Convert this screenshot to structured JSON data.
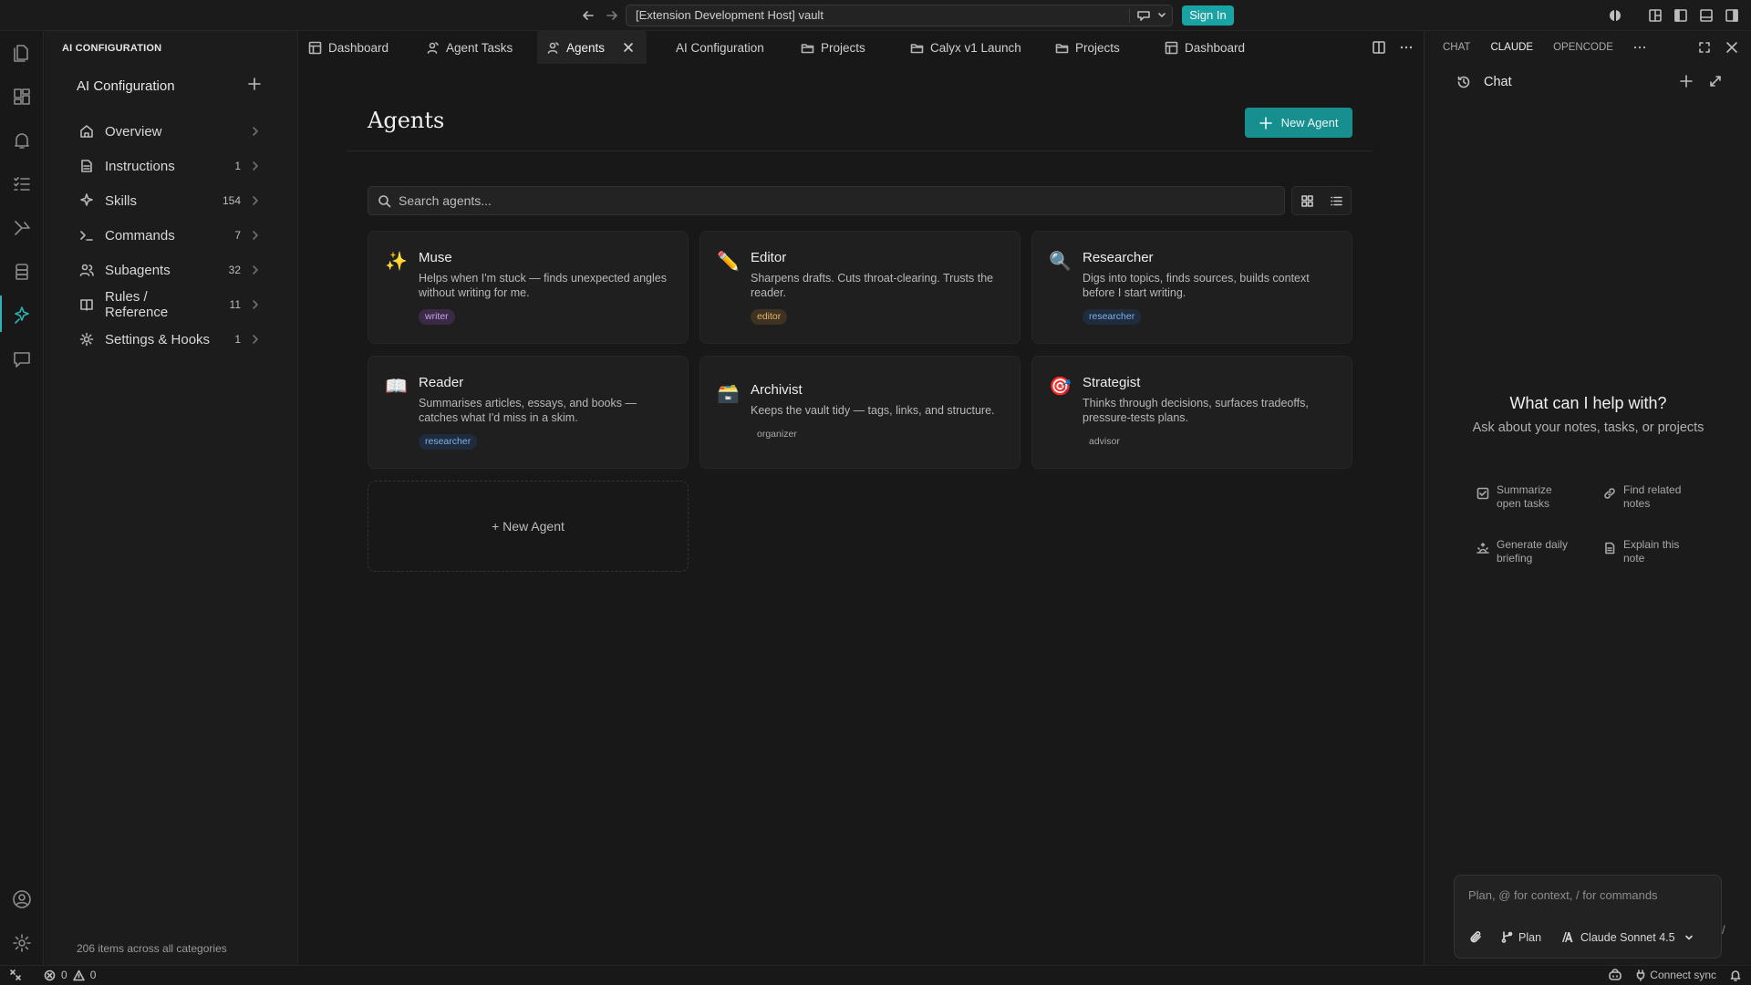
{
  "titlebar": {
    "command_center": "[Extension Development Host] vault",
    "signin_label": "Sign In"
  },
  "sidebar": {
    "header": "AI CONFIGURATION",
    "title": "AI Configuration",
    "items": [
      {
        "label": "Overview",
        "count": "",
        "icon": "home-icon"
      },
      {
        "label": "Instructions",
        "count": "1",
        "icon": "document-icon"
      },
      {
        "label": "Skills",
        "count": "154",
        "icon": "sparkle-icon"
      },
      {
        "label": "Commands",
        "count": "7",
        "icon": "terminal-icon"
      },
      {
        "label": "Subagents",
        "count": "32",
        "icon": "users-icon"
      },
      {
        "label": "Rules / Reference",
        "count": "11",
        "icon": "book-icon"
      },
      {
        "label": "Settings & Hooks",
        "count": "1",
        "icon": "gear-icon"
      }
    ],
    "footer": "206 items across all categories"
  },
  "tabs": [
    {
      "label": "Dashboard",
      "icon": "table-icon"
    },
    {
      "label": "Agent Tasks",
      "icon": "agent-icon"
    },
    {
      "label": "Agents",
      "icon": "agent-icon",
      "active": true
    },
    {
      "label": "AI Configuration",
      "icon": ""
    },
    {
      "label": "Projects",
      "icon": "folder-icon"
    },
    {
      "label": "Calyx v1 Launch",
      "icon": "folder-icon"
    },
    {
      "label": "Projects",
      "icon": "folder-icon"
    },
    {
      "label": "Dashboard",
      "icon": "table-icon"
    }
  ],
  "main": {
    "title": "Agents",
    "new_agent_label": "New Agent",
    "search_placeholder": "Search agents...",
    "agents": [
      {
        "emoji": "✨",
        "name": "Muse",
        "description": "Helps when I'm stuck — finds unexpected angles without writing for me.",
        "tag": "writer"
      },
      {
        "emoji": "✏️",
        "name": "Editor",
        "description": "Sharpens drafts. Cuts throat-clearing. Trusts the reader.",
        "tag": "editor"
      },
      {
        "emoji": "🔍",
        "name": "Researcher",
        "description": "Digs into topics, finds sources, builds context before I start writing.",
        "tag": "researcher"
      },
      {
        "emoji": "📖",
        "name": "Reader",
        "description": "Summarises articles, essays, and books — catches what I'd miss in a skim.",
        "tag": "researcher"
      },
      {
        "emoji": "🗃️",
        "name": "Archivist",
        "description": "Keeps the vault tidy — tags, links, and structure.",
        "tag": "organizer"
      },
      {
        "emoji": "🎯",
        "name": "Strategist",
        "description": "Thinks through decisions, surfaces tradeoffs, pressure-tests plans.",
        "tag": "advisor"
      }
    ],
    "new_agent_card_label": "+ New Agent"
  },
  "chat": {
    "tabs": [
      "CHAT",
      "CLAUDE",
      "OPENCODE"
    ],
    "active_tab": "CLAUDE",
    "header_title": "Chat",
    "heading": "What can I help with?",
    "subheading": "Ask about your notes, tasks, or projects",
    "suggestions": [
      {
        "label": "Summarize open tasks",
        "icon": "checkbox-icon"
      },
      {
        "label": "Find related notes",
        "icon": "link-icon"
      },
      {
        "label": "Generate daily briefing",
        "icon": "sunrise-icon"
      },
      {
        "label": "Explain this note",
        "icon": "note-icon"
      }
    ],
    "input_placeholder": "Plan, @ for context, / for commands",
    "plan_label": "Plan",
    "model_label": "Claude Sonnet 4.5",
    "slash": "/"
  },
  "statusbar": {
    "errors": "0",
    "warnings": "0",
    "connect_sync": "Connect sync"
  },
  "colors": {
    "accent": "#1aa3a3",
    "background": "#181818",
    "card": "#1f1f1f"
  }
}
